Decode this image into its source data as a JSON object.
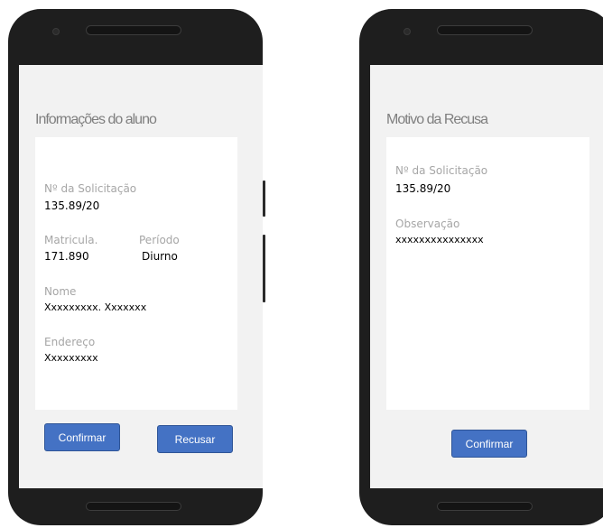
{
  "student_screen": {
    "title": "Informações do aluno",
    "request_number_label": "Nº da Solicitação",
    "request_number_value": "135.89/20",
    "registration_label": "Matricula.",
    "registration_value": "171.890",
    "period_label": "Período",
    "period_value": "Diurno",
    "name_label": "Nome",
    "name_value": "Xxxxxxxxx. Xxxxxxx",
    "address_label": "Endereço",
    "address_value": "Xxxxxxxxx",
    "confirm_label": "Confirmar",
    "reject_label": "Recusar"
  },
  "refusal_screen": {
    "title": "Motivo da Recusa",
    "request_number_label": "Nº da Solicitação",
    "request_number_value": "135.89/20",
    "observation_label": "Observação",
    "observation_value": "xxxxxxxxxxxxxxx",
    "confirm_label": "Confirmar"
  },
  "colors": {
    "button": "#4472c4",
    "phone_body": "#1e1e1e",
    "screen_bg": "#f2f2f2",
    "label_gray": "#a6a6a6",
    "title_gray": "#7f7f7f"
  }
}
